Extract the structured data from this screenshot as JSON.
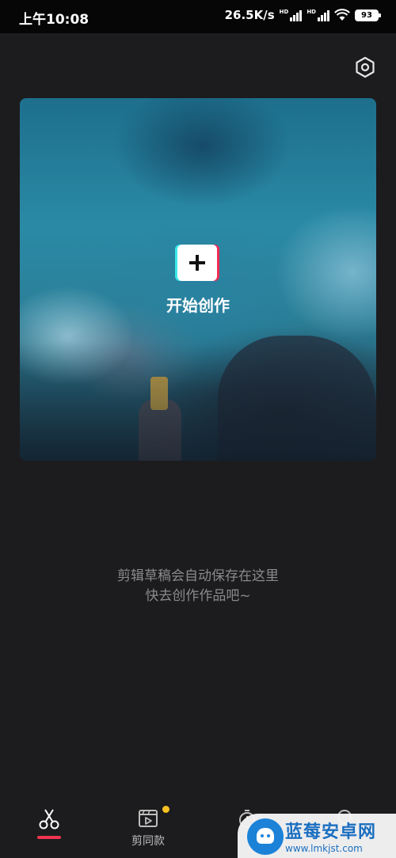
{
  "status_bar": {
    "time": "上午10:08",
    "net_speed": "26.5K/s",
    "signal_badge_1": "HD",
    "signal_badge_2": "HD",
    "battery": "93"
  },
  "header": {
    "settings_icon": "settings-hexagon-icon"
  },
  "hero": {
    "create_icon": "plus-icon",
    "create_label": "开始创作"
  },
  "drafts": {
    "empty_line1": "剪辑草稿会自动保存在这里",
    "empty_line2": "快去创作作品吧~"
  },
  "tab_bar": {
    "tabs": [
      {
        "icon": "scissors-icon",
        "label": "",
        "active": true
      },
      {
        "icon": "template-play-icon",
        "label": "剪同款",
        "badge": true
      },
      {
        "icon": "timer-icon",
        "label": ""
      },
      {
        "icon": "search-icon",
        "label": ""
      }
    ]
  },
  "watermark": {
    "title": "蓝莓安卓网",
    "url": "www.lmkjst.com"
  },
  "colors": {
    "background": "#1c1c1e",
    "accent_red": "#f0344f",
    "accent_cyan": "#3de8e8",
    "badge_yellow": "#f6c023",
    "hint_gray": "#8a8a8e"
  }
}
